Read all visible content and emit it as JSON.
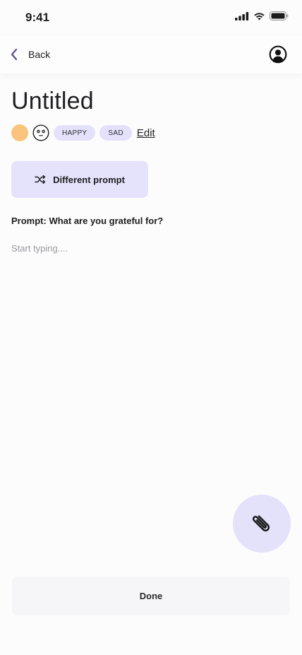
{
  "status_bar": {
    "time": "9:41",
    "icons": [
      "cellular-signal-icon",
      "wifi-icon",
      "battery-icon"
    ]
  },
  "nav": {
    "back_label": "Back",
    "back_icon": "chevron-left-icon",
    "profile_icon": "user-circle-icon"
  },
  "entry": {
    "title": "Untitled",
    "mood_color": "#fbc47e",
    "mood_icon": "neutral-face-icon",
    "tags": [
      "HAPPY",
      "SAD"
    ],
    "edit_label": "Edit",
    "prompt_button_label": "Different prompt",
    "prompt_button_icon": "shuffle-icon",
    "prompt": "Prompt: What are you grateful for?",
    "body_value": "",
    "body_placeholder": "Start typing...."
  },
  "attach": {
    "icon": "paperclip-icon"
  },
  "footer": {
    "done_label": "Done"
  },
  "colors": {
    "accent": "#e4e2fb",
    "accent_dark": "#5b4b8a",
    "background": "#fcfcfc",
    "done_background": "#f6f5f8"
  }
}
